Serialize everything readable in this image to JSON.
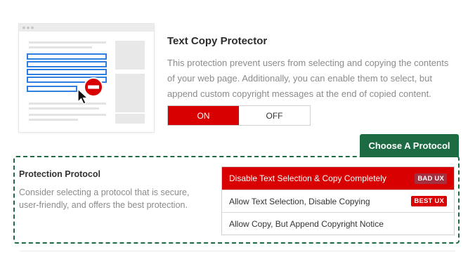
{
  "feature": {
    "title": "Text Copy Protector",
    "description": "This protection prevent users from selecting and copying the contents of your web page. Additionally, you can enable them to select, but append custom copyright messages at the end of copied content."
  },
  "toggle": {
    "on_label": "ON",
    "off_label": "OFF",
    "state": "on"
  },
  "choose_tab": {
    "label": "Choose A Protocol"
  },
  "protection_protocol": {
    "title": "Protection Protocol",
    "description": "Consider selecting a protocol that is secure, user-friendly, and offers the best protection."
  },
  "options": [
    {
      "label": "Disable Text Selection & Copy Completely",
      "badge": "BAD UX",
      "selected": true
    },
    {
      "label": "Allow Text Selection, Disable Copying",
      "badge": "BEST UX",
      "selected": false
    },
    {
      "label": "Allow Copy, But Append Copyright Notice",
      "badge": "",
      "selected": false
    }
  ],
  "illustration": {
    "icon": "no-entry-icon",
    "cursor": "mouse-pointer-icon"
  },
  "colors": {
    "accent_red": "#d80000",
    "accent_green": "#1c6b43",
    "selection_blue": "#2f7fe0",
    "bad_badge": "#a4303f"
  }
}
